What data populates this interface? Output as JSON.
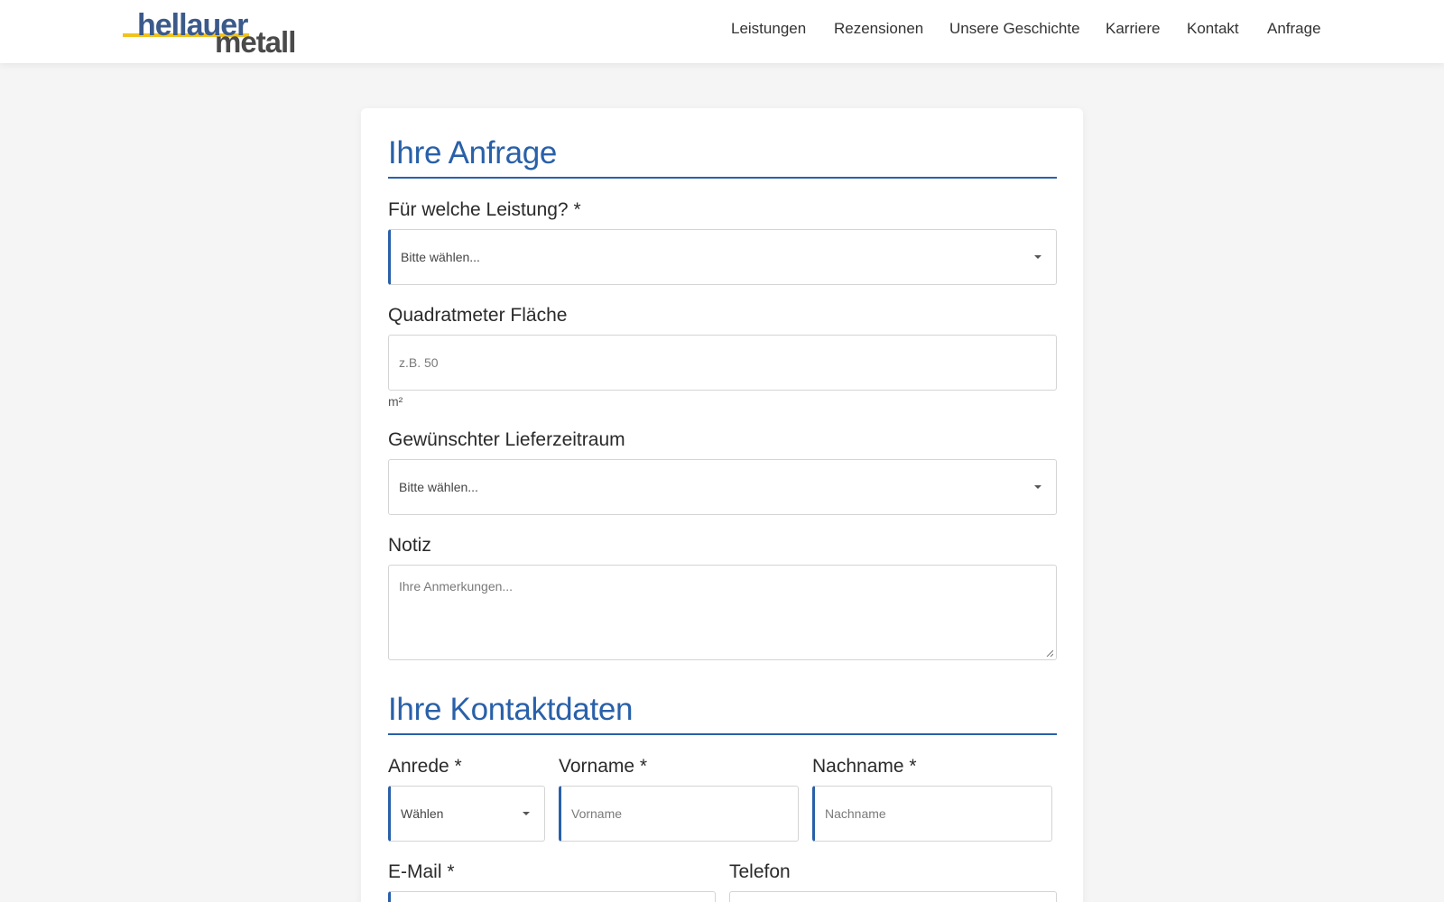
{
  "brand": {
    "logo_line1": "hellauer",
    "logo_line2": "metall",
    "accent_yellow": "#f2c21b",
    "logo_blue": "#3b5a8a",
    "logo_grey": "#4a4a4a"
  },
  "nav": {
    "items": [
      "Leistungen",
      "Rezensionen",
      "Unsere Geschichte",
      "Karriere",
      "Kontakt",
      "Anfrage"
    ]
  },
  "colors": {
    "primary": "#2960a9"
  },
  "form": {
    "section1_title": "Ihre Anfrage",
    "service": {
      "label": "Für welche Leistung? *",
      "value": "Bitte wählen..."
    },
    "area": {
      "label": "Quadratmeter Fläche",
      "placeholder": "z.B. 50",
      "unit": "m²"
    },
    "delivery": {
      "label": "Gewünschter Lieferzeitraum",
      "value": "Bitte wählen..."
    },
    "note": {
      "label": "Notiz",
      "placeholder": "Ihre Anmerkungen..."
    },
    "section2_title": "Ihre Kontaktdaten",
    "salutation": {
      "label": "Anrede *",
      "value": "Wählen"
    },
    "firstname": {
      "label": "Vorname *",
      "placeholder": "Vorname"
    },
    "lastname": {
      "label": "Nachname *",
      "placeholder": "Nachname"
    },
    "email": {
      "label": "E-Mail *"
    },
    "phone": {
      "label": "Telefon"
    }
  }
}
